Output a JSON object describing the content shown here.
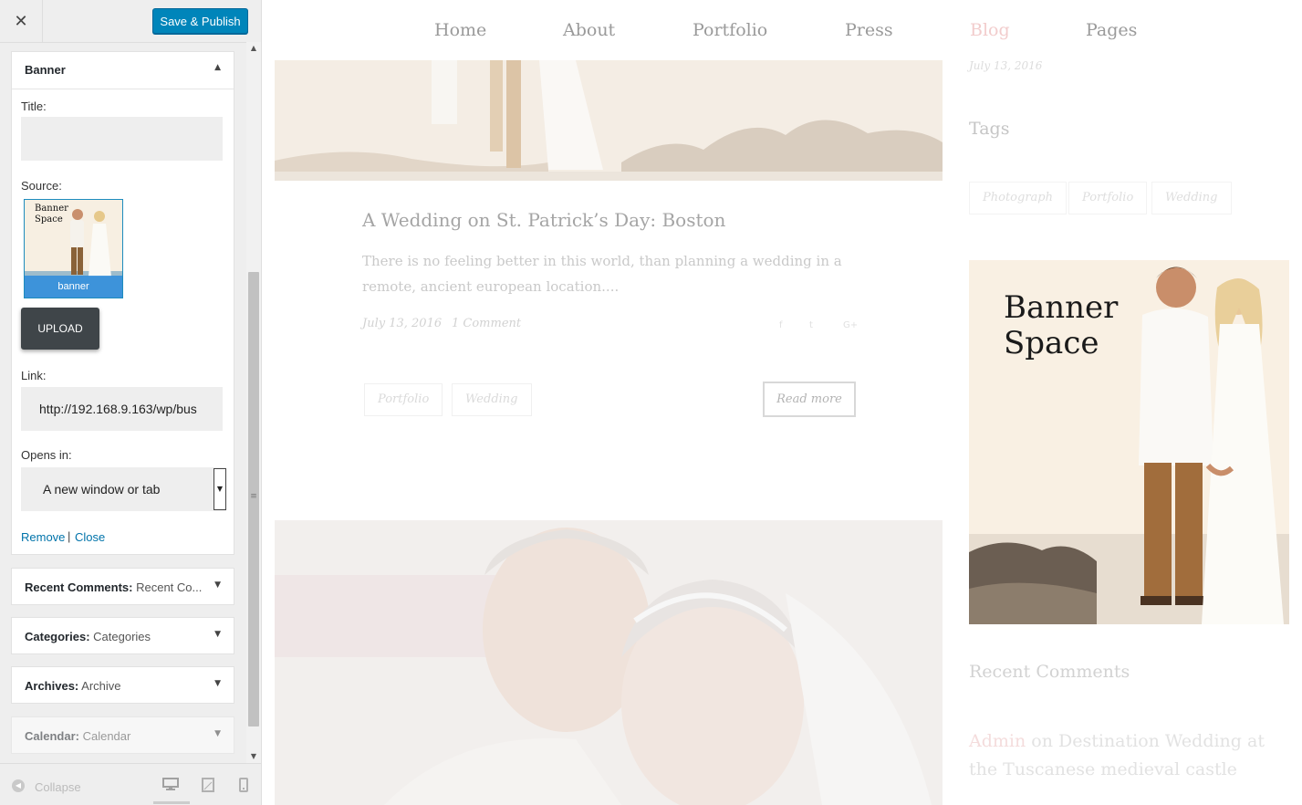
{
  "sidebar": {
    "header": {
      "close_symbol": "✕",
      "publish_label": "Save & Publish"
    },
    "banner_widget": {
      "title": "Banner",
      "fields": {
        "title_label": "Title:",
        "title_value": "",
        "source_label": "Source:",
        "thumb_text": "Banner Space",
        "thumb_caption": "banner",
        "upload_label": "UPLOAD",
        "link_label": "Link:",
        "link_value": "http://192.168.9.163/wp/bus",
        "opens_label": "Opens in:",
        "opens_value": "A new window or tab"
      },
      "actions": {
        "remove": "Remove",
        "separator": "|",
        "close": "Close"
      }
    },
    "widgets": [
      {
        "name": "Recent Comments:",
        "subtitle": "Recent Co..."
      },
      {
        "name": "Categories:",
        "subtitle": "Categories"
      },
      {
        "name": "Archives:",
        "subtitle": "Archive"
      },
      {
        "name": "Calendar:",
        "subtitle": "Calendar"
      }
    ],
    "footer": {
      "collapse_label": "Collapse"
    }
  },
  "preview": {
    "nav": [
      "Home",
      "About",
      "Portfolio",
      "Press",
      "Blog",
      "Pages"
    ],
    "active_nav_color": "#f2cccc",
    "post": {
      "title": "A Wedding on St. Patrick’s Day: Boston",
      "excerpt": "There is no feeling better in this world, than planning a wedding in a remote, ancient european location....",
      "date": "July 13, 2016",
      "comments": "1 Comment",
      "share_icons": [
        "f",
        "t",
        "G+"
      ],
      "tags": [
        "Portfolio",
        "Wedding"
      ],
      "read_more": "Read more"
    },
    "sidebar": {
      "date": "July 13, 2016",
      "tags_heading": "Tags",
      "tags": [
        "Photograph",
        "Portfolio",
        "Wedding"
      ],
      "banner_text": "Banner Space",
      "recent_comments_heading": "Recent Comments",
      "recent_comment": {
        "author": "Admin",
        "connector": "on",
        "post": "Destination Wedding at the Tuscanese medieval castle"
      }
    }
  },
  "colors": {
    "primary_button": "#0085ba",
    "link": "#0073aa",
    "upload_button": "#3f4549"
  }
}
